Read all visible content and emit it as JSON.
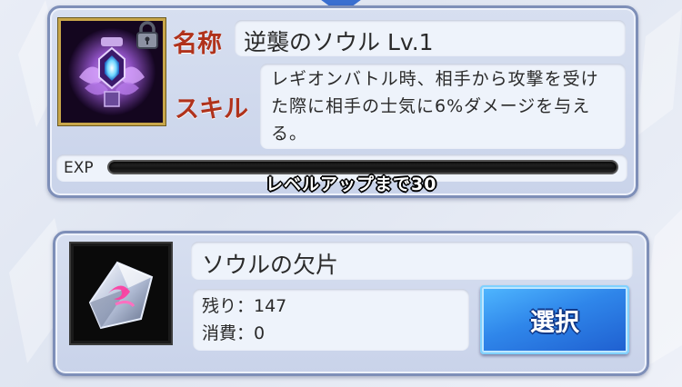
{
  "detail": {
    "name_label": "名称",
    "skill_label": "スキル",
    "name_value": "逆襲のソウル Lv.1",
    "skill_text": "レギオンバトル時、相手から攻撃を受けた際に相手の士気に6%ダメージを与える。",
    "exp_label": "EXP",
    "exp_fill_fraction": 0,
    "exp_text": "レベルアップまで30",
    "locked": true
  },
  "material": {
    "name": "ソウルの欠片",
    "remaining_line": "残り：147",
    "consumed_line": "消費：0",
    "select_label": "選択"
  },
  "colors": {
    "label_red": "#b0321b",
    "frame_gold": "#c8a64a",
    "button_blue": "#2f86ea",
    "exp_fill": "#5ab0ff"
  },
  "icons": {
    "soul": "soul-emblem-icon",
    "lock": "lock-icon",
    "shard": "soul-shard-icon"
  }
}
